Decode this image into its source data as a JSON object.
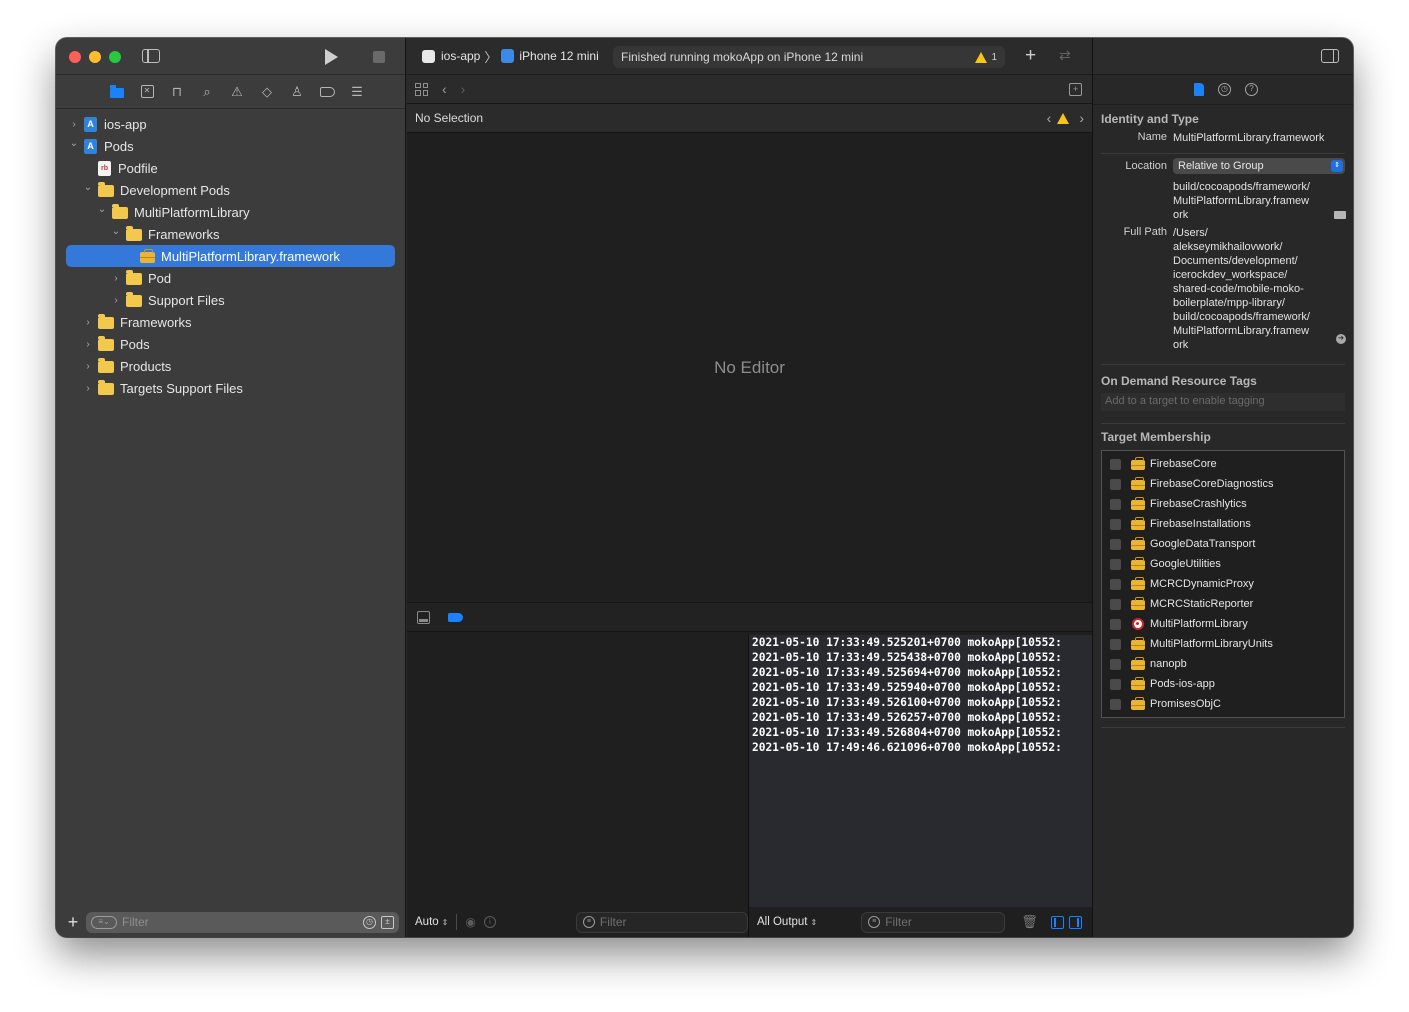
{
  "window": {
    "title_controls": {
      "close": "close",
      "minimize": "minimize",
      "zoom": "zoom"
    }
  },
  "toolbar": {
    "scheme": "ios-app",
    "scheme_separator": "〉",
    "destination": "iPhone 12 mini",
    "activity_message": "Finished running mokoApp on iPhone 12 mini",
    "warning_count": "1",
    "add_label": "+",
    "swap_label": "⇄"
  },
  "navigator": {
    "tabs": [
      "project-navigator",
      "source-control-navigator",
      "symbol-navigator",
      "find-navigator",
      "issue-navigator",
      "test-navigator",
      "debug-navigator",
      "breakpoint-navigator",
      "report-navigator"
    ],
    "active_tab": "project-navigator",
    "tree": [
      {
        "label": "ios-app",
        "icon": "xcode-project-icon",
        "depth": 0,
        "expanded": false,
        "has_children": true
      },
      {
        "label": "Pods",
        "icon": "xcode-project-icon",
        "depth": 0,
        "expanded": true,
        "has_children": true
      },
      {
        "label": "Podfile",
        "icon": "ruby-file-icon",
        "depth": 1,
        "has_children": false
      },
      {
        "label": "Development Pods",
        "icon": "folder-icon",
        "depth": 1,
        "expanded": true,
        "has_children": true
      },
      {
        "label": "MultiPlatformLibrary",
        "icon": "folder-icon",
        "depth": 2,
        "expanded": true,
        "has_children": true
      },
      {
        "label": "Frameworks",
        "icon": "folder-icon",
        "depth": 3,
        "expanded": true,
        "has_children": true
      },
      {
        "label": "MultiPlatformLibrary.framework",
        "icon": "framework-icon",
        "depth": 4,
        "has_children": false,
        "selected": true
      },
      {
        "label": "Pod",
        "icon": "folder-icon",
        "depth": 3,
        "expanded": false,
        "has_children": true
      },
      {
        "label": "Support Files",
        "icon": "folder-icon",
        "depth": 3,
        "expanded": false,
        "has_children": true
      },
      {
        "label": "Frameworks",
        "icon": "folder-icon",
        "depth": 1,
        "expanded": false,
        "has_children": true
      },
      {
        "label": "Pods",
        "icon": "folder-icon",
        "depth": 1,
        "expanded": false,
        "has_children": true
      },
      {
        "label": "Products",
        "icon": "folder-icon",
        "depth": 1,
        "expanded": false,
        "has_children": true
      },
      {
        "label": "Targets Support Files",
        "icon": "folder-icon",
        "depth": 1,
        "expanded": false,
        "has_children": true
      }
    ],
    "filter_placeholder": "Filter",
    "add_label": "+"
  },
  "editor": {
    "jump_bar_text": "No Selection",
    "empty_message": "No Editor"
  },
  "debug": {
    "variables_scope": "Auto",
    "variables_filter_placeholder": "Filter",
    "console_scope": "All Output",
    "console_filter_placeholder": "Filter",
    "console_lines": [
      "2021-05-10 17:33:49.525201+0700 mokoApp[10552:",
      "2021-05-10 17:33:49.525438+0700 mokoApp[10552:",
      "2021-05-10 17:33:49.525694+0700 mokoApp[10552:",
      "2021-05-10 17:33:49.525940+0700 mokoApp[10552:",
      "2021-05-10 17:33:49.526100+0700 mokoApp[10552:",
      "2021-05-10 17:33:49.526257+0700 mokoApp[10552:",
      "2021-05-10 17:33:49.526804+0700 mokoApp[10552:",
      "2021-05-10 17:49:46.621096+0700 mokoApp[10552:"
    ]
  },
  "inspector": {
    "tabs": [
      "file-inspector",
      "history-inspector",
      "quick-help-inspector"
    ],
    "identity_title": "Identity and Type",
    "name_label": "Name",
    "name_value": "MultiPlatformLibrary.framework",
    "location_label": "Location",
    "location_value": "Relative to Group",
    "location_path_lines": [
      "build/cocoapods/framework/",
      "MultiPlatformLibrary.framew",
      "ork"
    ],
    "full_path_label": "Full Path",
    "full_path_lines": [
      "/Users/",
      "alekseymikhailovwork/",
      "Documents/development/",
      "icerockdev_workspace/",
      "shared-code/mobile-moko-",
      "boilerplate/mpp-library/",
      "build/cocoapods/framework/",
      "MultiPlatformLibrary.framew",
      "ork"
    ],
    "odr_title": "On Demand Resource Tags",
    "odr_placeholder": "Add to a target to enable tagging",
    "membership_title": "Target Membership",
    "targets": [
      {
        "name": "FirebaseCore",
        "icon": "framework-icon",
        "checked": false
      },
      {
        "name": "FirebaseCoreDiagnostics",
        "icon": "framework-icon",
        "checked": false
      },
      {
        "name": "FirebaseCrashlytics",
        "icon": "framework-icon",
        "checked": false
      },
      {
        "name": "FirebaseInstallations",
        "icon": "framework-icon",
        "checked": false
      },
      {
        "name": "GoogleDataTransport",
        "icon": "framework-icon",
        "checked": false
      },
      {
        "name": "GoogleUtilities",
        "icon": "framework-icon",
        "checked": false
      },
      {
        "name": "MCRCDynamicProxy",
        "icon": "framework-icon",
        "checked": false
      },
      {
        "name": "MCRCStaticReporter",
        "icon": "framework-icon",
        "checked": false
      },
      {
        "name": "MultiPlatformLibrary",
        "icon": "aggregate-target-icon",
        "checked": false
      },
      {
        "name": "MultiPlatformLibraryUnits",
        "icon": "framework-icon",
        "checked": false
      },
      {
        "name": "nanopb",
        "icon": "framework-icon",
        "checked": false
      },
      {
        "name": "Pods-ios-app",
        "icon": "framework-icon",
        "checked": false
      },
      {
        "name": "PromisesObjC",
        "icon": "framework-icon",
        "checked": false
      }
    ]
  },
  "colors": {
    "accent": "#1a82fb",
    "selection": "#3478d9",
    "warning": "#f5c518",
    "folder": "#f2c94c"
  }
}
